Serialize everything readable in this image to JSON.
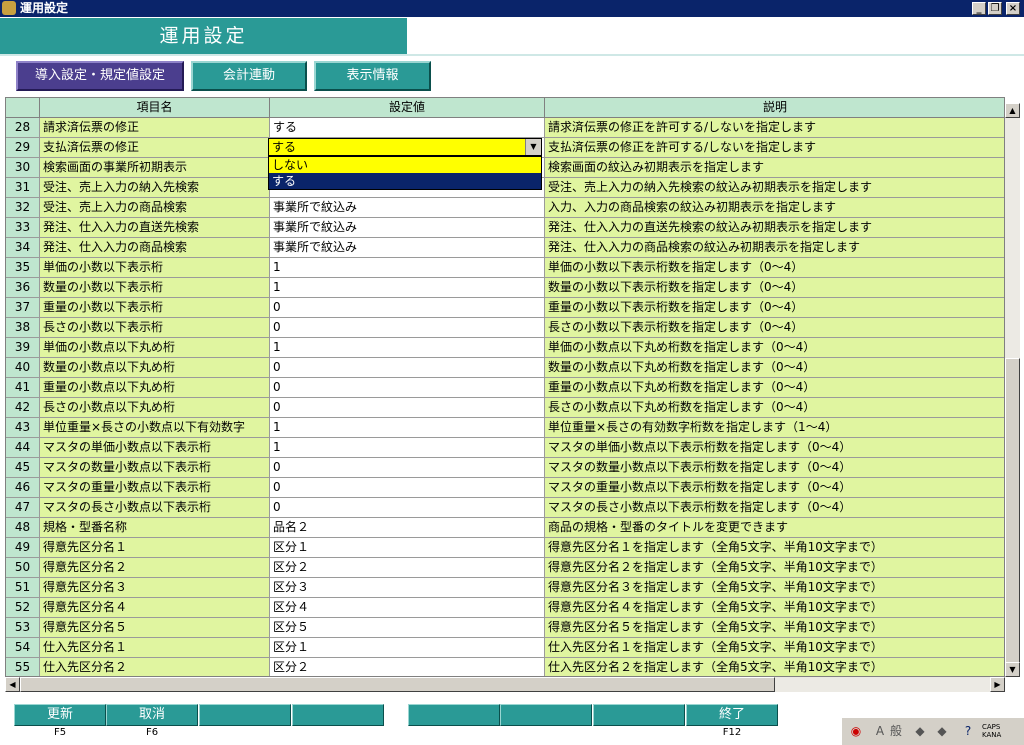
{
  "window": {
    "title": "運用設定",
    "minimize": "_",
    "maximize": "❐",
    "close": "×"
  },
  "header": {
    "title": "運用設定"
  },
  "tabs": [
    {
      "label": "導入設定・規定値設定",
      "active": true
    },
    {
      "label": "会計連動",
      "active": false
    },
    {
      "label": "表示情報",
      "active": false
    }
  ],
  "grid": {
    "columns": [
      "",
      "項目名",
      "設定値",
      "説明"
    ],
    "rows": [
      {
        "no": "28",
        "name": "請求済伝票の修正",
        "value": "する",
        "desc": "請求済伝票の修正を許可する/しないを指定します"
      },
      {
        "no": "29",
        "name": "支払済伝票の修正",
        "value": "",
        "desc": "支払済伝票の修正を許可する/しないを指定します"
      },
      {
        "no": "30",
        "name": "検索画面の事業所初期表示",
        "value": "",
        "desc": "検索画面の紋込み初期表示を指定します"
      },
      {
        "no": "31",
        "name": "受注、売上入力の納入先検索",
        "value": "",
        "desc": "受注、売上入力の納入先検索の紋込み初期表示を指定します"
      },
      {
        "no": "32",
        "name": "受注、売上入力の商品検索",
        "value": "事業所で紋込み",
        "desc": "入力、入力の商品検索の紋込み初期表示を指定します"
      },
      {
        "no": "33",
        "name": "発注、仕入入力の直送先検索",
        "value": "事業所で紋込み",
        "desc": "発注、仕入入力の直送先検索の紋込み初期表示を指定します"
      },
      {
        "no": "34",
        "name": "発注、仕入入力の商品検索",
        "value": "事業所で紋込み",
        "desc": "発注、仕入入力の商品検索の紋込み初期表示を指定します"
      },
      {
        "no": "35",
        "name": "単価の小数以下表示桁",
        "value": "1",
        "desc": "単価の小数以下表示桁数を指定します（0～4）"
      },
      {
        "no": "36",
        "name": "数量の小数以下表示桁",
        "value": "1",
        "desc": "数量の小数以下表示桁数を指定します（0～4）"
      },
      {
        "no": "37",
        "name": "重量の小数以下表示桁",
        "value": "0",
        "desc": "重量の小数以下表示桁数を指定します（0～4）"
      },
      {
        "no": "38",
        "name": "長さの小数以下表示桁",
        "value": "0",
        "desc": "長さの小数以下表示桁数を指定します（0～4）"
      },
      {
        "no": "39",
        "name": "単価の小数点以下丸め桁",
        "value": "1",
        "desc": "単価の小数点以下丸め桁数を指定します（0～4）"
      },
      {
        "no": "40",
        "name": "数量の小数点以下丸め桁",
        "value": "0",
        "desc": "数量の小数点以下丸め桁数を指定します（0～4）"
      },
      {
        "no": "41",
        "name": "重量の小数点以下丸め桁",
        "value": "0",
        "desc": "重量の小数点以下丸め桁数を指定します（0～4）"
      },
      {
        "no": "42",
        "name": "長さの小数点以下丸め桁",
        "value": "0",
        "desc": "長さの小数点以下丸め桁数を指定します（0～4）"
      },
      {
        "no": "43",
        "name": "単位重量×長さの小数点以下有効数字",
        "value": "1",
        "desc": "単位重量×長さの有効数字桁数を指定します（1～4）"
      },
      {
        "no": "44",
        "name": "マスタの単価小数点以下表示桁",
        "value": "1",
        "desc": "マスタの単価小数点以下表示桁数を指定します（0～4）"
      },
      {
        "no": "45",
        "name": "マスタの数量小数点以下表示桁",
        "value": "0",
        "desc": "マスタの数量小数点以下表示桁数を指定します（0～4）"
      },
      {
        "no": "46",
        "name": "マスタの重量小数点以下表示桁",
        "value": "0",
        "desc": "マスタの重量小数点以下表示桁数を指定します（0～4）"
      },
      {
        "no": "47",
        "name": "マスタの長さ小数点以下表示桁",
        "value": "0",
        "desc": "マスタの長さ小数点以下表示桁数を指定します（0～4）"
      },
      {
        "no": "48",
        "name": "規格・型番名称",
        "value": "品名２",
        "desc": "商品の規格・型番のタイトルを変更できます"
      },
      {
        "no": "49",
        "name": "得意先区分名１",
        "value": "区分１",
        "desc": "得意先区分名１を指定します（全角5文字、半角10文字まで）"
      },
      {
        "no": "50",
        "name": "得意先区分名２",
        "value": "区分２",
        "desc": "得意先区分名２を指定します（全角5文字、半角10文字まで）"
      },
      {
        "no": "51",
        "name": "得意先区分名３",
        "value": "区分３",
        "desc": "得意先区分名３を指定します（全角5文字、半角10文字まで）"
      },
      {
        "no": "52",
        "name": "得意先区分名４",
        "value": "区分４",
        "desc": "得意先区分名４を指定します（全角5文字、半角10文字まで）"
      },
      {
        "no": "53",
        "name": "得意先区分名５",
        "value": "区分５",
        "desc": "得意先区分名５を指定します（全角5文字、半角10文字まで）"
      },
      {
        "no": "54",
        "name": "仕入先区分名１",
        "value": "区分１",
        "desc": "仕入先区分名１を指定します（全角5文字、半角10文字まで）"
      },
      {
        "no": "55",
        "name": "仕入先区分名２",
        "value": "区分２",
        "desc": "仕入先区分名２を指定します（全角5文字、半角10文字まで）"
      }
    ]
  },
  "combo": {
    "selected": "する",
    "options": [
      "しない",
      "する"
    ],
    "highlighted_index": 1
  },
  "function_keys": [
    {
      "label": "更新",
      "key": "F5"
    },
    {
      "label": "取消",
      "key": "F6"
    },
    {
      "label": "",
      "key": ""
    },
    {
      "label": "",
      "key": ""
    },
    {
      "label": "",
      "key": ""
    },
    {
      "label": "",
      "key": ""
    },
    {
      "label": "",
      "key": ""
    },
    {
      "label": "終了",
      "key": "F12"
    }
  ],
  "tray": {
    "ime_mode": "般",
    "caps": "CAPS",
    "kana": "KANA"
  },
  "colors": {
    "accent": "#2a9a96",
    "active_tab": "#4b3e8e",
    "row_label_bg": "#e0f5a0",
    "header_bg": "#bfe6cf",
    "combo_bg": "#ffff00"
  }
}
